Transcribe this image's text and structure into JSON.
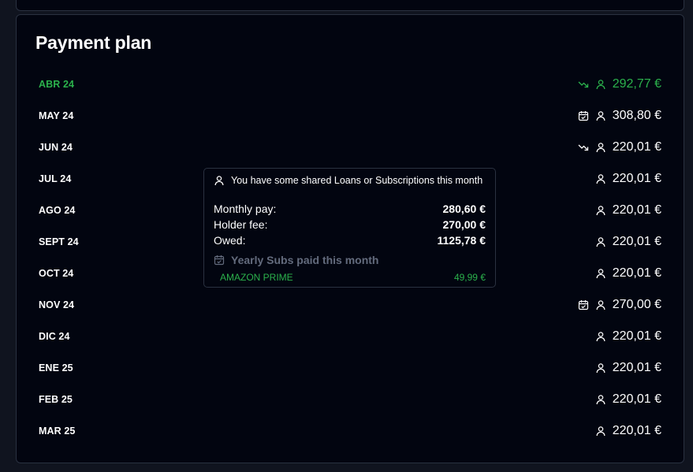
{
  "page": {
    "title": "Payment plan"
  },
  "colors": {
    "background": "#020510",
    "accent_green": "#2bb24c",
    "border": "#2a3140",
    "muted": "#636b7d"
  },
  "rows": [
    {
      "month": "ABR 24",
      "amount": "292,77 €",
      "icons": [
        "trend-down-icon",
        "user-icon"
      ],
      "highlight": true
    },
    {
      "month": "MAY 24",
      "amount": "308,80 €",
      "icons": [
        "calendar-check-icon",
        "user-icon"
      ]
    },
    {
      "month": "JUN 24",
      "amount": "220,01 €",
      "icons": [
        "trend-down-icon",
        "user-icon"
      ]
    },
    {
      "month": "JUL 24",
      "amount": "220,01 €",
      "icons": [
        "user-icon"
      ]
    },
    {
      "month": "AGO 24",
      "amount": "220,01 €",
      "icons": [
        "user-icon"
      ]
    },
    {
      "month": "SEPT 24",
      "amount": "220,01 €",
      "icons": [
        "user-icon"
      ]
    },
    {
      "month": "OCT 24",
      "amount": "220,01 €",
      "icons": [
        "user-icon"
      ]
    },
    {
      "month": "NOV 24",
      "amount": "270,00 €",
      "icons": [
        "calendar-check-icon",
        "user-icon"
      ]
    },
    {
      "month": "DIC 24",
      "amount": "220,01 €",
      "icons": [
        "user-icon"
      ]
    },
    {
      "month": "ENE 25",
      "amount": "220,01 €",
      "icons": [
        "user-icon"
      ]
    },
    {
      "month": "FEB 25",
      "amount": "220,01 €",
      "icons": [
        "user-icon"
      ]
    },
    {
      "month": "MAR 25",
      "amount": "220,01 €",
      "icons": [
        "user-icon"
      ]
    }
  ],
  "tooltip": {
    "heading": "You have some shared Loans or Subscriptions this month",
    "lines": [
      {
        "label": "Monthly pay:",
        "value": "280,60 €"
      },
      {
        "label": "Holder fee:",
        "value": "270,00 €"
      },
      {
        "label": "Owed:",
        "value": "1125,78 €"
      }
    ],
    "subs_heading": "Yearly Subs paid this month",
    "subs": [
      {
        "name": "AMAZON PRIME",
        "value": "49,99 €"
      }
    ]
  }
}
